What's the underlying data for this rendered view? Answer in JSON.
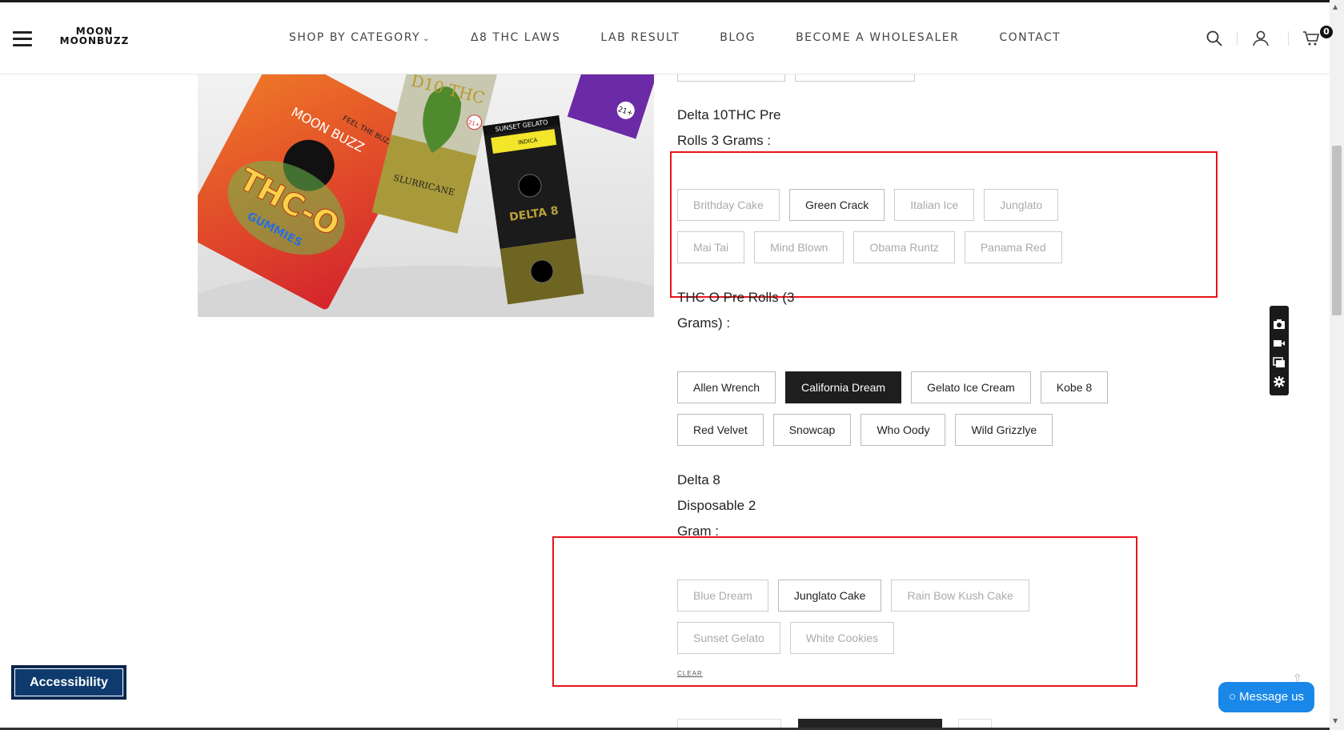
{
  "header": {
    "logo_line1": "MOON",
    "logo_line2": "MOONBUZZ",
    "nav": [
      {
        "label": "SHOP BY CATEGORY",
        "chevron": "⌄"
      },
      {
        "label": "Δ8 THC LAWS"
      },
      {
        "label": "LAB RESULT"
      },
      {
        "label": "BLOG"
      },
      {
        "label": "BECOME A WHOLESALER"
      },
      {
        "label": "CONTACT"
      }
    ],
    "icons": [
      "search-icon",
      "account-icon",
      "cart-icon"
    ],
    "cart_count": "0"
  },
  "product_image": {
    "brand": "MOON BUZZ",
    "pack1": "THC-O",
    "pack1_sub": "GUMMIES",
    "pack1_tag": "FEEL THE BUZZ",
    "pack2_title": "D10 THC",
    "pack2_name": "SLURRICANE",
    "pack3_title": "SUNSET GELATO",
    "pack3_strain": "INDICA",
    "pack3_product": "DELTA 8",
    "age_badge": "21+"
  },
  "sections": [
    {
      "title_lines": [
        "Delta 10THC Pre",
        "Rolls 3 Grams :"
      ],
      "rows": [
        [
          {
            "label": "Brithday Cake",
            "state": "unavailable"
          },
          {
            "label": "Green Crack",
            "state": "available"
          },
          {
            "label": "Italian Ice",
            "state": "unavailable"
          },
          {
            "label": "Junglato",
            "state": "unavailable"
          }
        ],
        [
          {
            "label": "Mai Tai",
            "state": "unavailable"
          },
          {
            "label": "Mind Blown",
            "state": "unavailable"
          },
          {
            "label": "Obama Runtz",
            "state": "unavailable"
          },
          {
            "label": "Panama Red",
            "state": "unavailable"
          }
        ]
      ]
    },
    {
      "title_lines": [
        "THC O Pre Rolls (3",
        "Grams) :"
      ],
      "rows": [
        [
          {
            "label": "Allen Wrench",
            "state": "available"
          },
          {
            "label": "California Dream",
            "state": "selected"
          },
          {
            "label": "Gelato Ice Cream",
            "state": "available"
          },
          {
            "label": "Kobe 8",
            "state": "available"
          }
        ],
        [
          {
            "label": "Red Velvet",
            "state": "available"
          },
          {
            "label": "Snowcap",
            "state": "available"
          },
          {
            "label": "Who Oody",
            "state": "available"
          },
          {
            "label": "Wild Grizzlye",
            "state": "available"
          }
        ]
      ]
    },
    {
      "title_lines": [
        "Delta 8",
        "Disposable 2",
        "Gram :"
      ],
      "rows": [
        [
          {
            "label": "Blue Dream",
            "state": "unavailable"
          },
          {
            "label": "Junglato Cake",
            "state": "available"
          },
          {
            "label": "Rain Bow Kush Cake",
            "state": "unavailable"
          }
        ],
        [
          {
            "label": "Sunset Gelato",
            "state": "unavailable"
          },
          {
            "label": "White Cookies",
            "state": "unavailable"
          }
        ]
      ]
    }
  ],
  "clear_label": "CLEAR",
  "floating_toolbar_icons": [
    "camera-icon",
    "video-icon",
    "window-icon",
    "gear-icon"
  ],
  "accessibility_label": "Accessibility",
  "message_label": "Message us",
  "colors": {
    "highlight": "#e8141c",
    "selected_bg": "#1e1e1e",
    "accessibility_bg": "#0e3a6e",
    "message_bg": "#1a88e8"
  }
}
